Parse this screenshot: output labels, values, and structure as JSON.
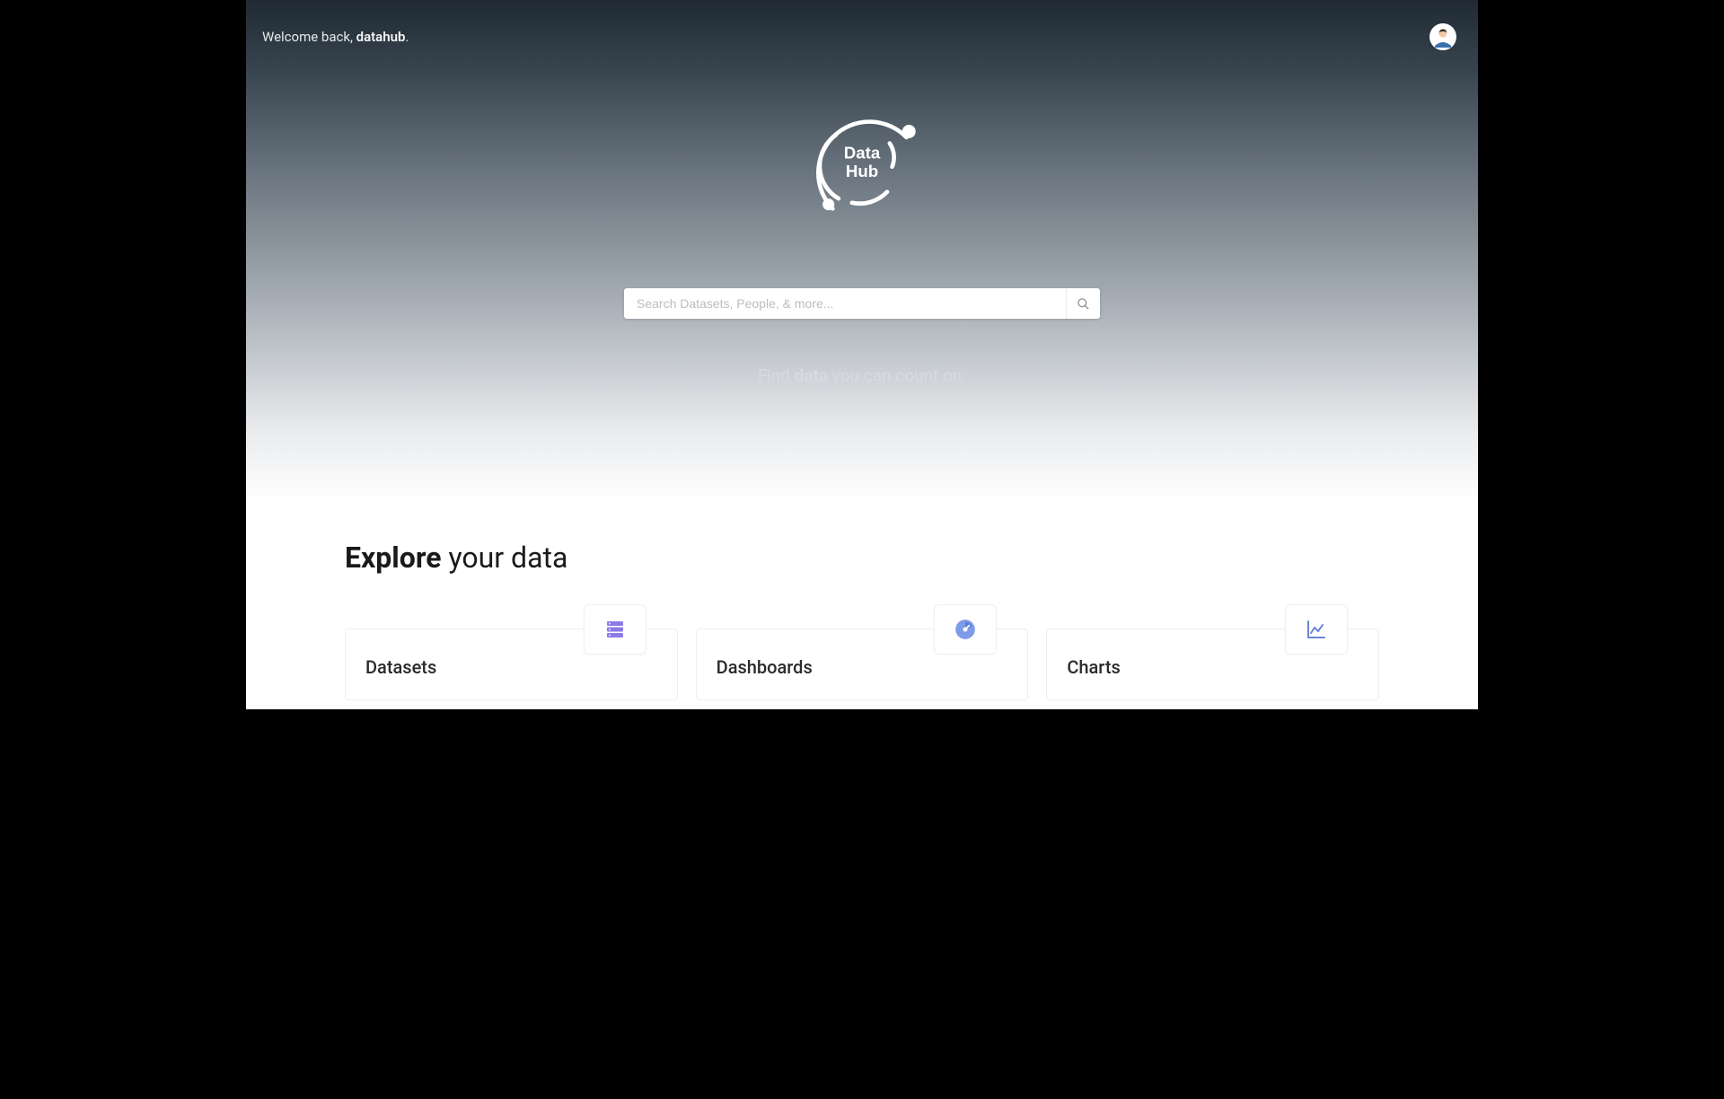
{
  "header": {
    "welcome_prefix": "Welcome back, ",
    "username": "datahub",
    "welcome_suffix": "."
  },
  "logo": {
    "line1": "Data",
    "line2": "Hub"
  },
  "search": {
    "placeholder": "Search Datasets, People, & more..."
  },
  "tagline": {
    "prefix": "Find ",
    "emph": "data",
    "suffix": " you can count on."
  },
  "explore": {
    "heading_bold": "Explore",
    "heading_rest": " your data",
    "cards": [
      {
        "title": "Datasets",
        "icon": "datasets"
      },
      {
        "title": "Dashboards",
        "icon": "dashboards"
      },
      {
        "title": "Charts",
        "icon": "charts"
      }
    ]
  }
}
